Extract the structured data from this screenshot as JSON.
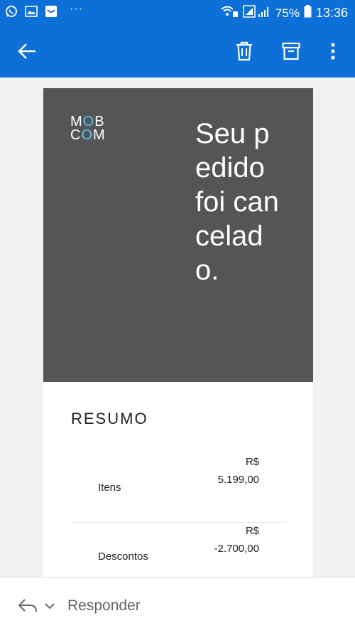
{
  "status_bar": {
    "battery": "75%",
    "time": "13:36",
    "dots": "···",
    "icons": [
      "whatsapp-icon",
      "gallery-icon",
      "mail-app-icon",
      "wifi-icon",
      "signal-icon",
      "battery-icon"
    ]
  },
  "app_bar": {
    "icons": [
      "back-arrow-icon",
      "trash-icon",
      "archive-icon",
      "more-vert-icon"
    ]
  },
  "email": {
    "logo_line1_a": "M",
    "logo_line1_o": "O",
    "logo_line1_b": "B",
    "logo_line2_c": "C",
    "logo_line2_o": "O",
    "logo_line2_m": "M",
    "title": "Seu pedido foi cancelado.",
    "section_title": "RESUMO",
    "rows": [
      {
        "label": "Itens",
        "currency": "R$",
        "amount": "5.199,00"
      },
      {
        "label": "Descontos",
        "currency": "R$",
        "amount": "-2.700,00"
      }
    ]
  },
  "bottom_bar": {
    "reply_label": "Responder"
  },
  "colors": {
    "app_blue": "#0d6fd8",
    "hero_gray": "#545557",
    "logo_accent": "#58c3e4"
  }
}
